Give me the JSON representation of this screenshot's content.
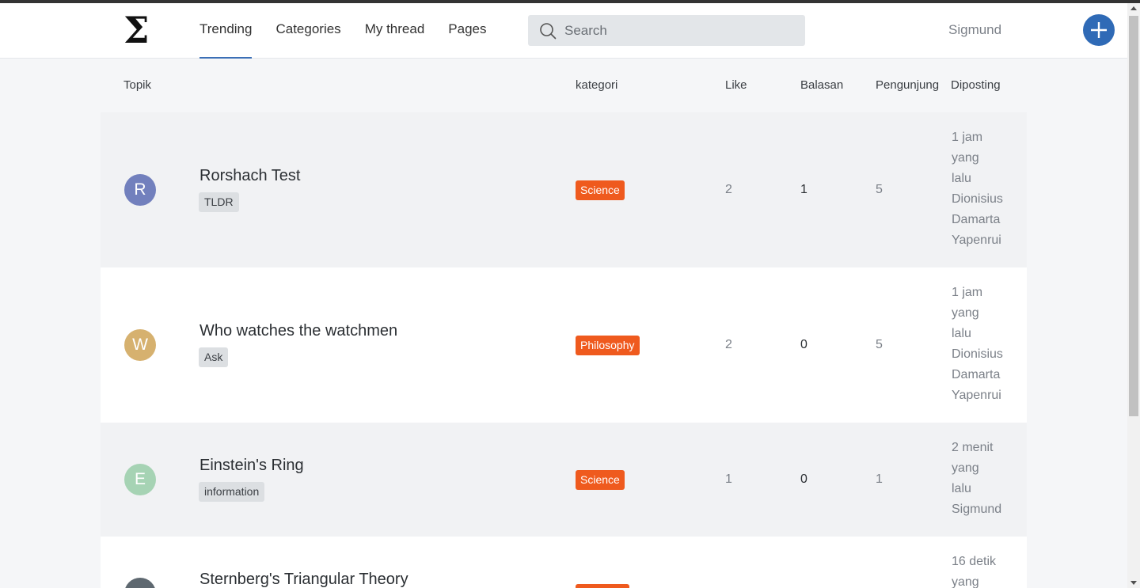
{
  "header": {
    "logo_symbol": "Σ",
    "nav": [
      {
        "label": "Trending",
        "active": true
      },
      {
        "label": "Categories",
        "active": false
      },
      {
        "label": "My thread",
        "active": false
      },
      {
        "label": "Pages",
        "active": false
      }
    ],
    "search": {
      "placeholder": "Search",
      "icon": "search-icon"
    },
    "username": "Sigmund",
    "add_button_icon": "plus-icon"
  },
  "colors": {
    "accent": "#2f6ab6",
    "category_badge": "#ef5a1e"
  },
  "table": {
    "columns": {
      "topic": "Topik",
      "category": "kategori",
      "like": "Like",
      "replies": "Balasan",
      "visitors": "Pengunjung",
      "posted": "Diposting"
    },
    "rows": [
      {
        "avatar_letter": "R",
        "avatar_color": "#7280bd",
        "title": "Rorshach Test",
        "tag": "TLDR",
        "category": "Science",
        "like": "2",
        "replies": "1",
        "visitors": "5",
        "posted_lines": [
          "1 jam",
          "yang",
          "lalu",
          "Dionisius",
          "Damarta",
          "Yapenrui"
        ]
      },
      {
        "avatar_letter": "W",
        "avatar_color": "#d6b16f",
        "title": "Who watches the watchmen",
        "tag": "Ask",
        "category": "Philosophy",
        "like": "2",
        "replies": "0",
        "visitors": "5",
        "posted_lines": [
          "1 jam",
          "yang",
          "lalu",
          "Dionisius",
          "Damarta",
          "Yapenrui"
        ]
      },
      {
        "avatar_letter": "E",
        "avatar_color": "#a6d3b4",
        "title": "Einstein's Ring",
        "tag": "information",
        "category": "Science",
        "like": "1",
        "replies": "0",
        "visitors": "1",
        "posted_lines": [
          "2 menit",
          "yang",
          "lalu",
          "Sigmund"
        ]
      },
      {
        "avatar_letter": "",
        "avatar_color": "#5e6870",
        "title": "Sternberg's Triangular Theory",
        "tag": "",
        "category": "",
        "like": "",
        "replies": "",
        "visitors": "",
        "posted_lines": [
          "16 detik",
          "yang"
        ]
      }
    ]
  }
}
